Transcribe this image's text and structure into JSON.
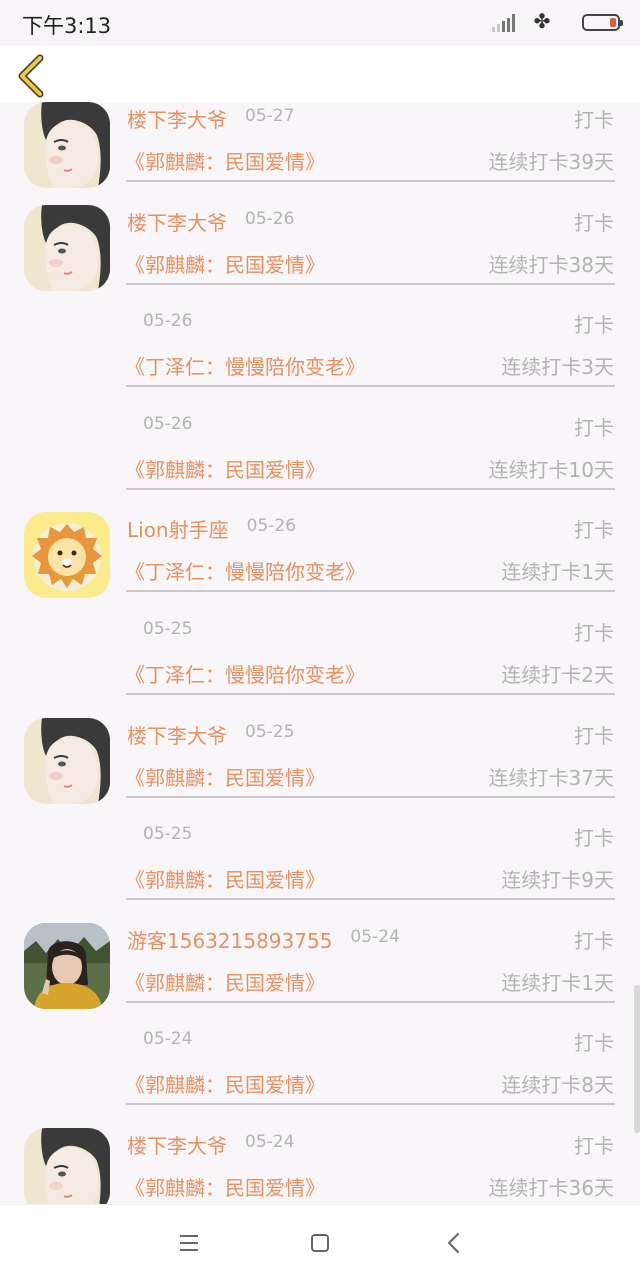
{
  "status_bar": {
    "time": "下午3:13"
  },
  "nav": {
    "back_icon": "chevron-left-icon",
    "accent_color": "#f0c93a"
  },
  "theme": {
    "name_color": "#e8915f",
    "meta_color": "#b3b3b3"
  },
  "feed": [
    {
      "user": "楼下李大爷",
      "avatar": "girl",
      "date": "05-27",
      "action": "打卡",
      "title": "《郭麒麟：民国爱情》",
      "streak": "连续打卡39天"
    },
    {
      "user": "楼下李大爷",
      "avatar": "girl",
      "date": "05-26",
      "action": "打卡",
      "title": "《郭麒麟：民国爱情》",
      "streak": "连续打卡38天"
    },
    {
      "user": "",
      "avatar": "",
      "date": "05-26",
      "action": "打卡",
      "title": "《丁泽仁：慢慢陪你变老》",
      "streak": "连续打卡3天"
    },
    {
      "user": "",
      "avatar": "",
      "date": "05-26",
      "action": "打卡",
      "title": "《郭麒麟：民国爱情》",
      "streak": "连续打卡10天"
    },
    {
      "user": "Lion射手座",
      "avatar": "lion",
      "date": "05-26",
      "action": "打卡",
      "title": "《丁泽仁：慢慢陪你变老》",
      "streak": "连续打卡1天"
    },
    {
      "user": "",
      "avatar": "",
      "date": "05-25",
      "action": "打卡",
      "title": "《丁泽仁：慢慢陪你变老》",
      "streak": "连续打卡2天"
    },
    {
      "user": "楼下李大爷",
      "avatar": "girl",
      "date": "05-25",
      "action": "打卡",
      "title": "《郭麒麟：民国爱情》",
      "streak": "连续打卡37天"
    },
    {
      "user": "",
      "avatar": "",
      "date": "05-25",
      "action": "打卡",
      "title": "《郭麒麟：民国爱情》",
      "streak": "连续打卡9天"
    },
    {
      "user": "游客1563215893755",
      "avatar": "photo",
      "date": "05-24",
      "action": "打卡",
      "title": "《郭麒麟：民国爱情》",
      "streak": "连续打卡1天"
    },
    {
      "user": "",
      "avatar": "",
      "date": "05-24",
      "action": "打卡",
      "title": "《郭麒麟：民国爱情》",
      "streak": "连续打卡8天"
    },
    {
      "user": "楼下李大爷",
      "avatar": "girl",
      "date": "05-24",
      "action": "打卡",
      "title": "《郭麒麟：民国爱情》",
      "streak": "连续打卡36天"
    }
  ],
  "system_nav": {
    "menu_icon": "menu-icon",
    "home_icon": "home-square-icon",
    "back_icon": "back-triangle-icon"
  }
}
